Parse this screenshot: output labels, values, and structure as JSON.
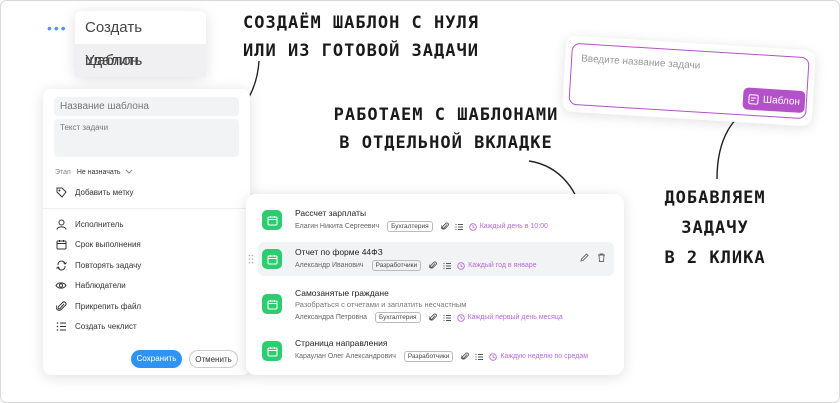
{
  "dropdown_menu": {
    "items": [
      {
        "label": "Создать шаблон"
      },
      {
        "label": "Удалить"
      }
    ]
  },
  "annotations": {
    "create_template": [
      "Создаём шаблон с нуля",
      "или из готовой задачи"
    ],
    "templates_tab": [
      "Работаем с шаблонами",
      "в отдельной вкладке"
    ],
    "add_task": [
      "Добавляем",
      "задачу",
      "в 2 клика"
    ]
  },
  "template_form": {
    "name_placeholder": "Название шаблона",
    "text_placeholder": "Текст задачи",
    "stage_label": "Этап",
    "stage_value": "Не назначать",
    "add_tag": "Добавить метку",
    "options": [
      {
        "icon": "user-icon",
        "label": "Исполнитель"
      },
      {
        "icon": "calendar-icon",
        "label": "Срок выполнения"
      },
      {
        "icon": "repeat-icon",
        "label": "Повторять задачу"
      },
      {
        "icon": "eye-icon",
        "label": "Наблюдатели"
      },
      {
        "icon": "paperclip-icon",
        "label": "Прикрепить файл"
      },
      {
        "icon": "checklist-icon",
        "label": "Создать чеклист"
      }
    ],
    "save_label": "Сохранить",
    "cancel_label": "Отменить"
  },
  "task_input": {
    "placeholder": "Введите название задачи",
    "template_button": "Шаблон"
  },
  "templates": [
    {
      "title": "Рассчет зарплаты",
      "description": "",
      "assignee": "Елагин Никита Сергеевич",
      "tag": "Бухгалтерия",
      "recurrence": "Каждый день в 10:00"
    },
    {
      "title": "Отчет по форме 44ФЗ",
      "description": "",
      "assignee": "Александр Иванович",
      "tag": "Разработчики",
      "recurrence": "Каждый год в январе"
    },
    {
      "title": "Самозанятые граждане",
      "description": "Разобраться с отчетами и заплатить несчастным",
      "assignee": "Александра Петровна",
      "tag": "Бухгалтерия",
      "recurrence": "Каждый первый день месяца"
    },
    {
      "title": "Страница направления",
      "description": "",
      "assignee": "Караулан Олег Александрович",
      "tag": "Разработчики",
      "recurrence": "Каждую неделю по средам"
    }
  ],
  "colors": {
    "accent_blue": "#2f93f5",
    "green": "#2ecc71",
    "purple": "#b351c9"
  }
}
